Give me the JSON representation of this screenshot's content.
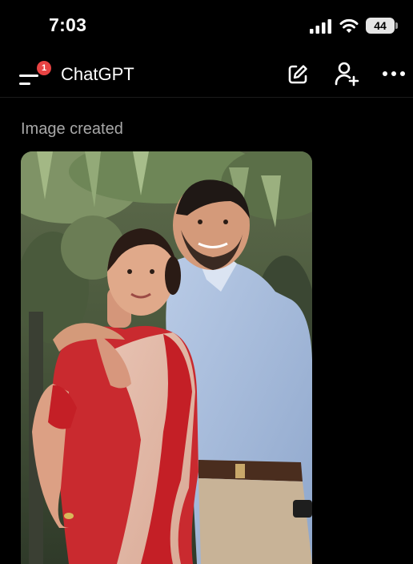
{
  "status_bar": {
    "time": "7:03",
    "battery_level": "44",
    "icons": [
      "signal-icon",
      "wifi-icon",
      "battery-icon"
    ]
  },
  "app_bar": {
    "title": "ChatGPT",
    "notification_badge": "1",
    "icons": [
      "menu-icon",
      "new-chat-icon",
      "add-user-icon",
      "more-icon"
    ]
  },
  "message": {
    "caption": "Image created"
  },
  "colors": {
    "background": "#000000",
    "caption_text": "#a8a8a8",
    "badge": "#e84343"
  }
}
